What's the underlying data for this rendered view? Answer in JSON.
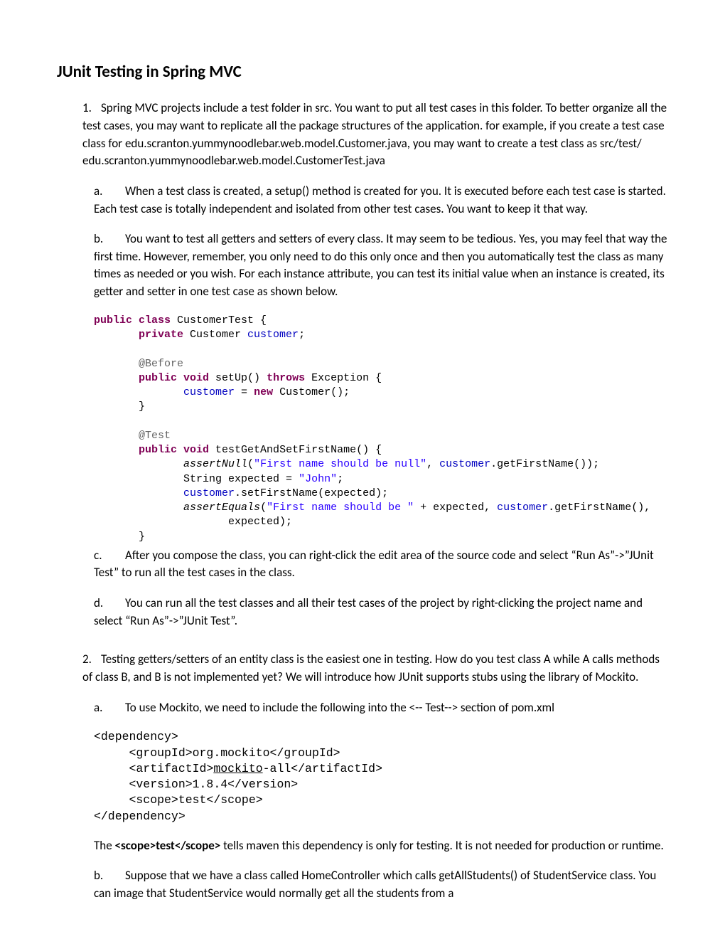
{
  "title": "JUnit Testing in Spring MVC",
  "s1": {
    "num": "1.",
    "text": "Spring MVC projects include a test folder in src. You want to put all test cases in this folder. To better organize all the test cases, you may want to replicate all the package structures of the application. for example, if you create a test case class for edu.scranton.yummynoodlebar.web.model.Customer.java, you may want to create a test class as src/test/ edu.scranton.yummynoodlebar.web.model.CustomerTest.java"
  },
  "s1a": {
    "letter": "a.",
    "text": "When a test class is created, a setup() method is created for you. It is executed before each test case is started. Each test case is totally independent and isolated from other test cases. You want to keep it that way."
  },
  "s1b": {
    "letter": "b.",
    "text": "You want to test all getters and setters of every class. It may seem to be tedious. Yes, you may feel that way the first time. However, remember, you only need to do this only once and then you automatically test the class as many times as needed or you wish. For each instance attribute, you can test its initial value when an instance is created, its getter and setter in one test case as shown below."
  },
  "code": {
    "l01a": "public",
    "l01b": " class",
    "l01c": " CustomerTest {",
    "l02a": "private",
    "l02b": " Customer ",
    "l02c": "customer",
    "l02d": ";",
    "l04a": "@Before",
    "l05a": "public",
    "l05b": " void",
    "l05c": " setUp() ",
    "l05d": "throws",
    "l05e": " Exception {",
    "l06a": "customer",
    "l06b": " = ",
    "l06c": "new",
    "l06d": " Customer();",
    "l07a": "}",
    "l09a": "@Test",
    "l10a": "public",
    "l10b": " void",
    "l10c": " testGetAndSetFirstName() {",
    "l11a": "assertNull",
    "l11b": "(",
    "l11c": "\"First name should be null\"",
    "l11d": ", ",
    "l11e": "customer",
    "l11f": ".getFirstName());",
    "l12a": "String expected = ",
    "l12b": "\"John\"",
    "l12c": ";",
    "l13a": "customer",
    "l13b": ".setFirstName(expected);",
    "l14a": "assertEquals",
    "l14b": "(",
    "l14c": "\"First name should be \"",
    "l14d": " + expected, ",
    "l14e": "customer",
    "l14f": ".getFirstName(),",
    "l15a": "expected);",
    "l16a": "}"
  },
  "s1c": {
    "letter": "c.",
    "text": "After you compose the class, you can right-click the edit area of the source code and select “Run As”->”JUnit Test” to run all the test cases in the class."
  },
  "s1d": {
    "letter": "d.",
    "text": "You can run all the test classes and all their test cases of the project by right-clicking the project name and select “Run As”->”JUnit Test”."
  },
  "s2": {
    "num": "2.",
    "text": "Testing getters/setters of an entity class is the easiest one in testing. How do you test class A while A calls methods of class B, and B is not implemented yet? We will introduce how JUnit supports stubs using the library of Mockito."
  },
  "s2a": {
    "letter": "a.",
    "text": "To use Mockito, we need to include the following into the <-- Test--> section of pom.xml"
  },
  "xml": {
    "l1": "<dependency>",
    "l2": "     <groupId>org.mockito</groupId>",
    "l3a": "     <artifactId>",
    "l3b": "mockito",
    "l3c": "-all</artifactId>",
    "l4": "     <version>1.8.4</version>",
    "l5": "     <scope>test</scope>",
    "l6": "</dependency>"
  },
  "s2a2": {
    "pre": "The ",
    "bold": "<scope>test</scope>",
    "post": " tells maven this dependency is only for testing. It is not needed for production or runtime."
  },
  "s2b": {
    "letter": "b.",
    "text": "Suppose that we have a class called HomeController which calls getAllStudents() of StudentService class. You can image that StudentService would normally get all the students from a"
  }
}
